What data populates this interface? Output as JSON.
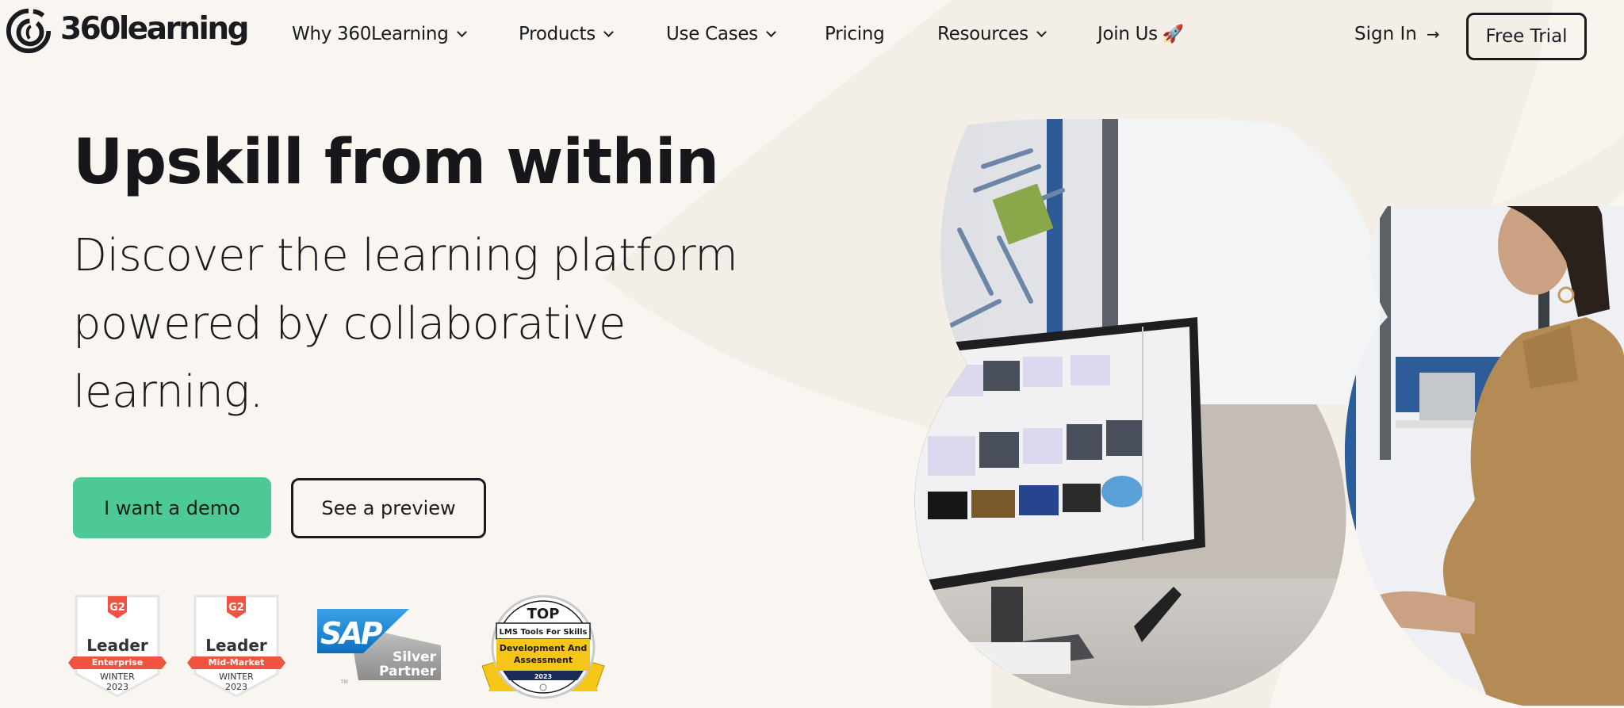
{
  "header": {
    "logo_text": "360learning",
    "nav": [
      {
        "label": "Why 360Learning",
        "has_dropdown": true
      },
      {
        "label": "Products",
        "has_dropdown": true
      },
      {
        "label": "Use Cases",
        "has_dropdown": true
      },
      {
        "label": "Pricing",
        "has_dropdown": false
      },
      {
        "label": "Resources",
        "has_dropdown": true
      },
      {
        "label": "Join Us",
        "has_dropdown": false,
        "emoji": "🚀"
      }
    ],
    "sign_in": "Sign In",
    "sign_in_arrow": "→",
    "free_trial": "Free Trial"
  },
  "hero": {
    "title": "Upskill from within",
    "subtitle_lines": [
      "Discover the learning platform",
      "powered by collaborative",
      "learning."
    ],
    "demo_button": "I want a demo",
    "preview_button": "See a preview"
  },
  "badges": {
    "g2": [
      {
        "logo": "G2",
        "title": "Leader",
        "segment": "Enterprise",
        "season": "WINTER",
        "year": "2023"
      },
      {
        "logo": "G2",
        "title": "Leader",
        "segment": "Mid-Market",
        "season": "WINTER",
        "year": "2023"
      }
    ],
    "sap": {
      "brand": "SAP",
      "line1": "Silver",
      "line2": "Partner",
      "tm": "TM"
    },
    "top": {
      "top": "TOP",
      "line1": "LMS Tools For Skills",
      "line2": "Development And",
      "line3": "Assessment",
      "year": "2023"
    }
  },
  "colors": {
    "background": "#f9f6f1",
    "accent_green": "#4cc994",
    "text": "#1b1b1f",
    "g2_red": "#f0533f",
    "sap_blue": "#1f8fd8"
  }
}
